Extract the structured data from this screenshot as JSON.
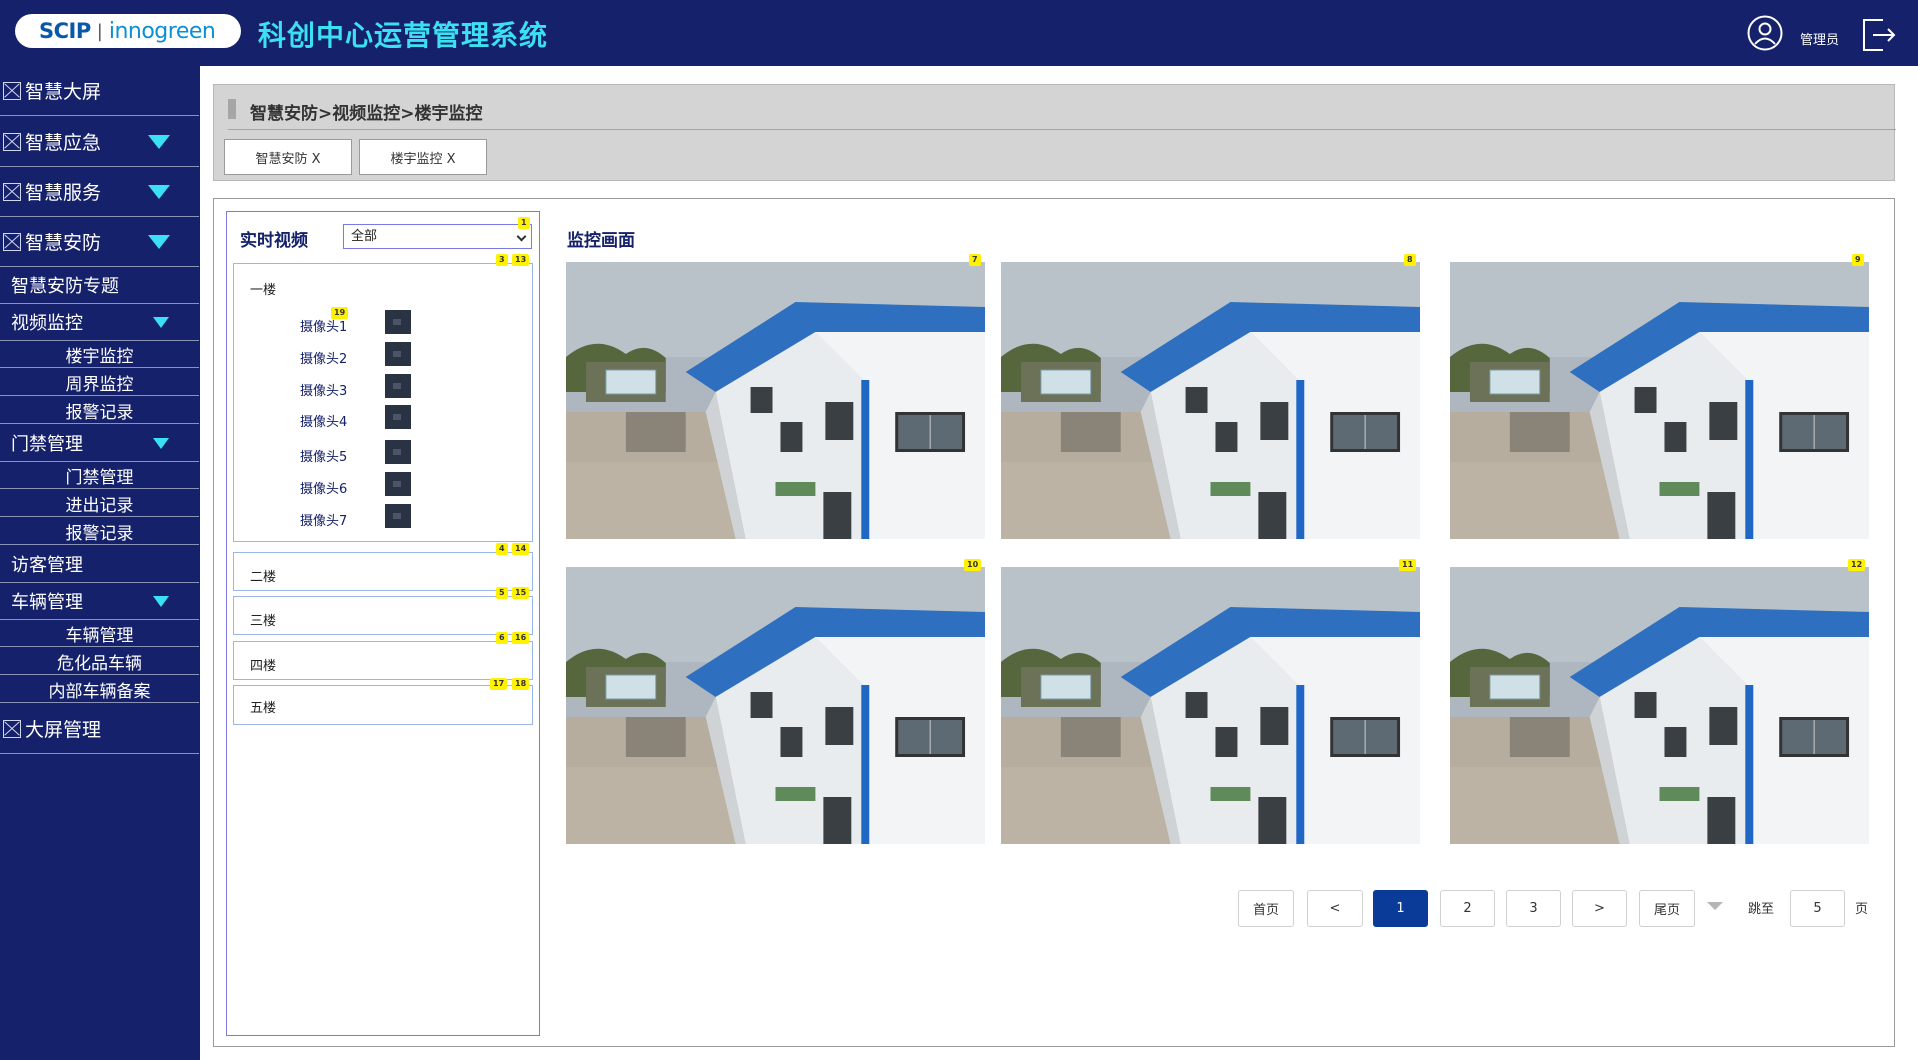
{
  "header": {
    "logo_left": "SCIP",
    "logo_sep": "|",
    "logo_right": "innogreen",
    "title": "科创中心运营管理系统",
    "user": "管理员"
  },
  "sidebar": {
    "items": [
      {
        "label": "智慧大屏"
      },
      {
        "label": "智慧应急"
      },
      {
        "label": "智慧服务"
      },
      {
        "label": "智慧安防"
      },
      {
        "label": "智慧安防专题"
      },
      {
        "label": "视频监控"
      },
      {
        "label": "楼宇监控"
      },
      {
        "label": "周界监控"
      },
      {
        "label": "报警记录"
      },
      {
        "label": "门禁管理"
      },
      {
        "label": "门禁管理"
      },
      {
        "label": "进出记录"
      },
      {
        "label": "报警记录"
      },
      {
        "label": "访客管理"
      },
      {
        "label": "车辆管理"
      },
      {
        "label": "车辆管理"
      },
      {
        "label": "危化品车辆"
      },
      {
        "label": "内部车辆备案"
      },
      {
        "label": "大屏管理"
      }
    ]
  },
  "breadcrumb": "智慧安防>视频监控>楼宇监控",
  "tabs": [
    {
      "label": "智慧安防 X"
    },
    {
      "label": "楼宇监控 X"
    }
  ],
  "realtime": {
    "title": "实时视频",
    "select_value": "全部"
  },
  "floors": [
    {
      "label": "一楼"
    },
    {
      "label": "二楼"
    },
    {
      "label": "三楼"
    },
    {
      "label": "四楼"
    },
    {
      "label": "五楼"
    }
  ],
  "cameras": [
    {
      "label": "摄像头1"
    },
    {
      "label": "摄像头2"
    },
    {
      "label": "摄像头3"
    },
    {
      "label": "摄像头4"
    },
    {
      "label": "摄像头5"
    },
    {
      "label": "摄像头6"
    },
    {
      "label": "摄像头7"
    }
  ],
  "monitor": {
    "title": "监控画面"
  },
  "badges": {
    "b1": "1",
    "b3": "3",
    "b13": "13",
    "b19": "19",
    "b4": "4",
    "b14": "14",
    "b5": "5",
    "b15": "15",
    "b6": "6",
    "b16": "16",
    "b17": "17",
    "b18": "18",
    "b7": "7",
    "b8": "8",
    "b9": "9",
    "b10": "10",
    "b11": "11",
    "b12": "12"
  },
  "pagination": {
    "first": "首页",
    "prev": "<",
    "pages": [
      "1",
      "2",
      "3"
    ],
    "next": ">",
    "last": "尾页",
    "jump_label": "跳至",
    "jump_value": "5",
    "page_unit": "页",
    "current_page": 1
  },
  "colors": {
    "header_bg": "#15216a",
    "accent": "#3be0f2",
    "active_page": "#0a3b98"
  }
}
